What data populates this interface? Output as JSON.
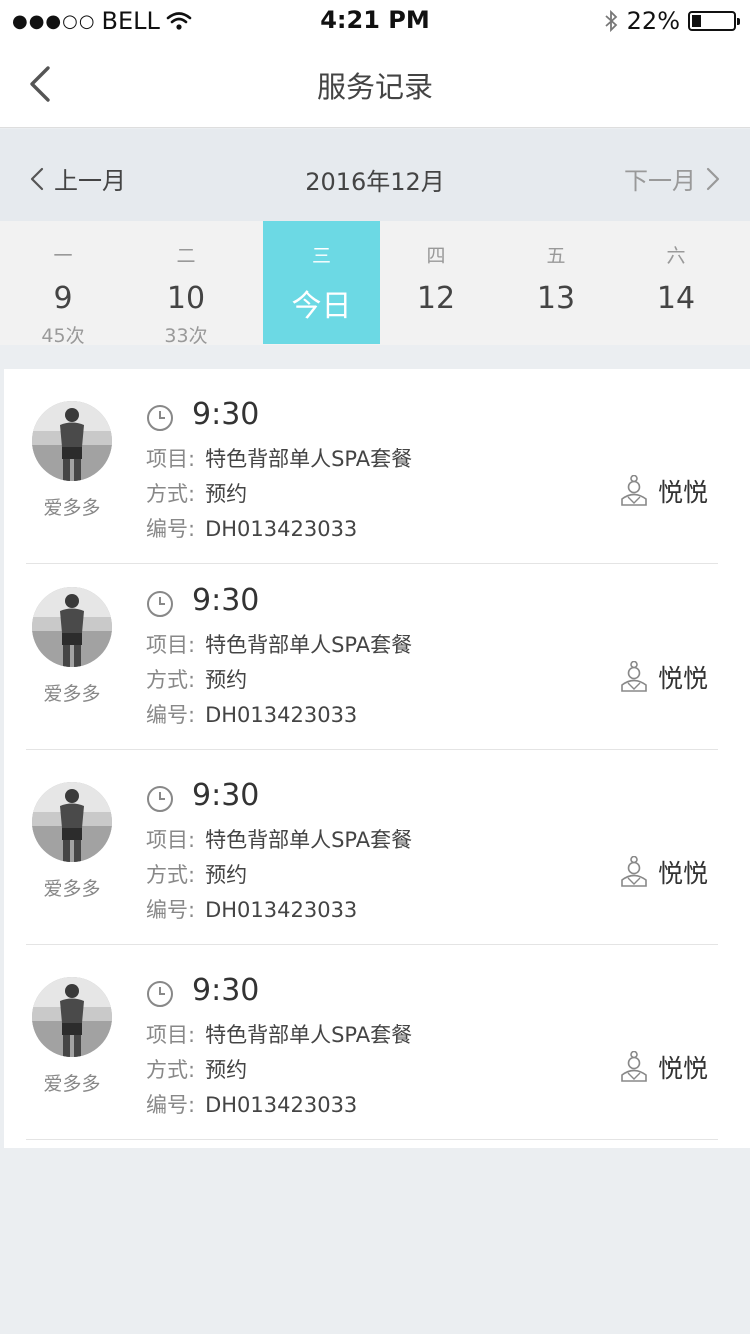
{
  "status_bar": {
    "carrier": "BELL",
    "time": "4:21 PM",
    "battery": "22%",
    "battery_level": 0.22
  },
  "header": {
    "title": "服务记录"
  },
  "month_nav": {
    "prev_label": "上一月",
    "current": "2016年12月",
    "next_label": "下一月"
  },
  "week": [
    {
      "weekday": "一",
      "date": "9",
      "count": "45次",
      "active": false
    },
    {
      "weekday": "二",
      "date": "10",
      "count": "33次",
      "active": false
    },
    {
      "weekday": "三",
      "date": "今日",
      "count": "",
      "active": true
    },
    {
      "weekday": "四",
      "date": "12",
      "count": "",
      "active": false
    },
    {
      "weekday": "五",
      "date": "13",
      "count": "",
      "active": false
    },
    {
      "weekday": "六",
      "date": "14",
      "count": "",
      "active": false
    }
  ],
  "records": [
    {
      "customer": "爱多多",
      "time": "9:30",
      "item_label": "项目:",
      "item": "特色背部单人SPA套餐",
      "method_label": "方式:",
      "method": "预约",
      "number_label": "编号:",
      "number": "DH013423033",
      "therapist": "悦悦"
    },
    {
      "customer": "爱多多",
      "time": "9:30",
      "item_label": "项目:",
      "item": "特色背部单人SPA套餐",
      "method_label": "方式:",
      "method": "预约",
      "number_label": "编号:",
      "number": "DH013423033",
      "therapist": "悦悦"
    },
    {
      "customer": "爱多多",
      "time": "9:30",
      "item_label": "项目:",
      "item": "特色背部单人SPA套餐",
      "method_label": "方式:",
      "method": "预约",
      "number_label": "编号:",
      "number": "DH013423033",
      "therapist": "悦悦"
    },
    {
      "customer": "爱多多",
      "time": "9:30",
      "item_label": "项目:",
      "item": "特色背部单人SPA套餐",
      "method_label": "方式:",
      "method": "预约",
      "number_label": "编号:",
      "number": "DH013423033",
      "therapist": "悦悦"
    }
  ],
  "icons": {
    "back": "chevron-left-icon",
    "prev_month": "chevron-left-icon",
    "next_month": "chevron-right-icon",
    "clock": "clock-icon",
    "therapist": "therapist-icon",
    "wifi": "wifi-icon",
    "bluetooth": "bluetooth-icon"
  },
  "colors": {
    "accent": "#6cd9e4",
    "background": "#ebeef1",
    "month_bar": "#e6eaee",
    "week_bar": "#f2f2f2"
  }
}
